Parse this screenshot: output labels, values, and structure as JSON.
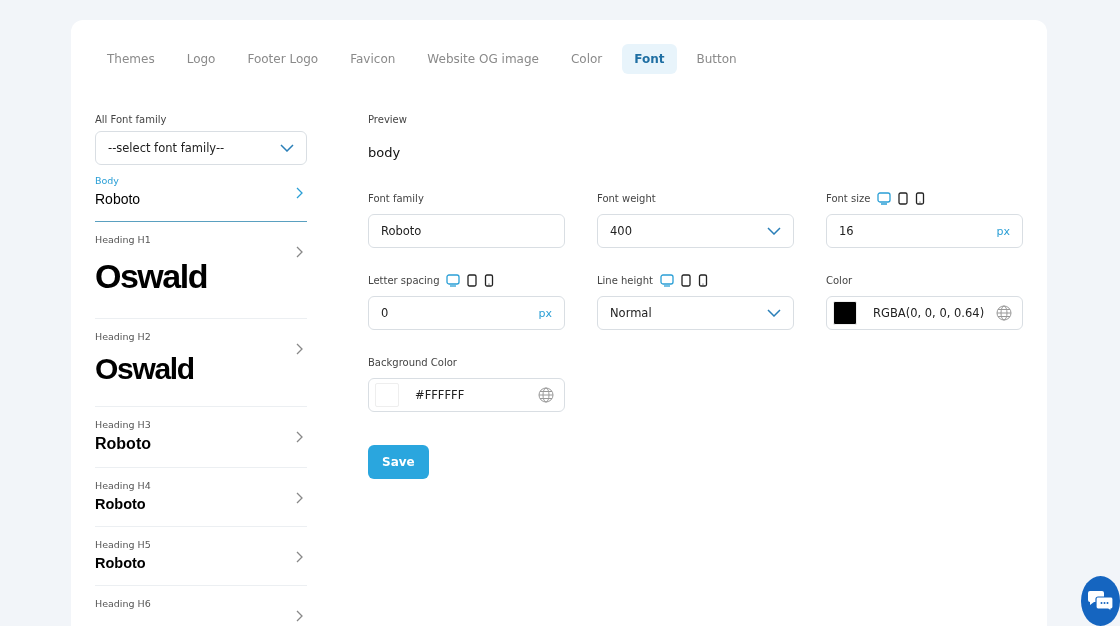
{
  "tabs": [
    {
      "label": "Themes",
      "selected": false
    },
    {
      "label": "Logo",
      "selected": false
    },
    {
      "label": "Footer Logo",
      "selected": false
    },
    {
      "label": "Favicon",
      "selected": false
    },
    {
      "label": "Website OG image",
      "selected": false
    },
    {
      "label": "Color",
      "selected": false
    },
    {
      "label": "Font",
      "selected": true
    },
    {
      "label": "Button",
      "selected": false
    }
  ],
  "sidebar": {
    "label": "All Font family",
    "select": {
      "value": "--select font family--"
    },
    "items": [
      {
        "kind": "body",
        "label": "Body",
        "font": "Roboto",
        "selected": true
      },
      {
        "kind": "h1",
        "label": "Heading H1",
        "font": "Oswald",
        "selected": false
      },
      {
        "kind": "h2",
        "label": "Heading H2",
        "font": "Oswald",
        "selected": false
      },
      {
        "kind": "h3",
        "label": "Heading H3",
        "font": "Roboto",
        "selected": false
      },
      {
        "kind": "h4",
        "label": "Heading H4",
        "font": "Roboto",
        "selected": false
      },
      {
        "kind": "h5",
        "label": "Heading H5",
        "font": "Roboto",
        "selected": false
      },
      {
        "kind": "h6",
        "label": "Heading H6",
        "selected": false
      }
    ]
  },
  "preview": {
    "label": "Preview",
    "text": "body"
  },
  "fields": [
    {
      "kind": "text",
      "label": "Font family",
      "value": "Roboto"
    },
    {
      "kind": "select",
      "label": "Font weight",
      "value": "400"
    },
    {
      "kind": "unit",
      "label": "Font size",
      "value": "16",
      "unit": "px",
      "devices": [
        {
          "kind": "desktop",
          "selected": true
        },
        {
          "kind": "tablet",
          "selected": false
        },
        {
          "kind": "mobile",
          "selected": false
        }
      ]
    },
    {
      "kind": "unit",
      "label": "Letter spacing",
      "value": "0",
      "unit": "px",
      "devices": [
        {
          "kind": "desktop",
          "selected": true
        },
        {
          "kind": "tablet",
          "selected": false
        },
        {
          "kind": "mobile",
          "selected": false
        }
      ]
    },
    {
      "kind": "select",
      "label": "Line height",
      "value": "Normal",
      "devices": [
        {
          "kind": "desktop",
          "selected": true
        },
        {
          "kind": "tablet",
          "selected": false
        },
        {
          "kind": "mobile",
          "selected": false
        }
      ]
    },
    {
      "kind": "color",
      "label": "Color",
      "value": "RGBA(0, 0, 0, 0.64)",
      "color": "#000000"
    },
    {
      "kind": "color",
      "label": "Background Color",
      "value": "#FFFFFF",
      "color": "#ffffff"
    }
  ],
  "save_button": "Save"
}
